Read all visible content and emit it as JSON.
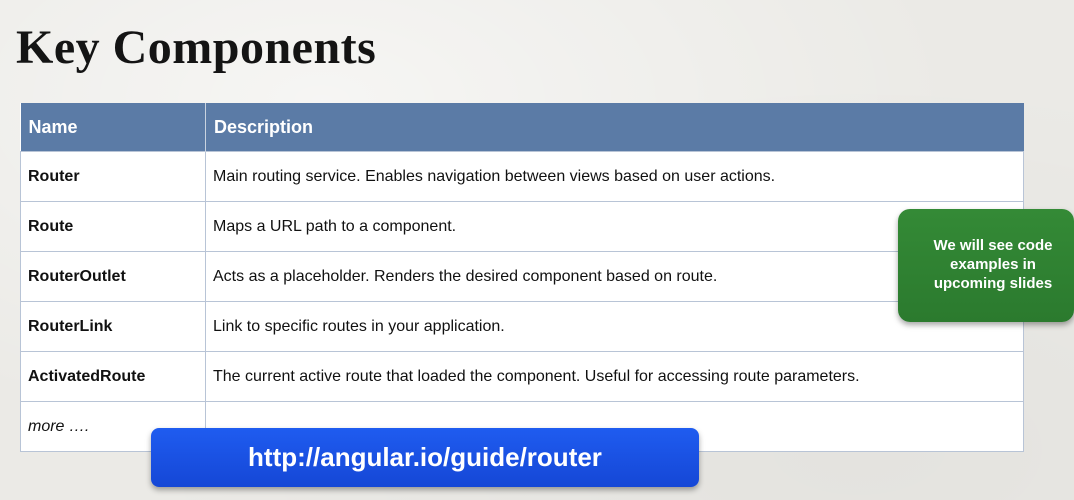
{
  "title": "Key Components",
  "table": {
    "headers": [
      "Name",
      "Description"
    ],
    "rows": [
      {
        "name": "Router",
        "description": "Main routing service. Enables navigation between views based on user actions."
      },
      {
        "name": "Route",
        "description": "Maps a URL path to a component."
      },
      {
        "name": "RouterOutlet",
        "description": "Acts as a placeholder. Renders the desired component based on route."
      },
      {
        "name": "RouterLink",
        "description": "Link to specific routes in your application."
      },
      {
        "name": "ActivatedRoute",
        "description": "The current active route that loaded the component. Useful for accessing route parameters."
      }
    ],
    "more_label": "more …."
  },
  "note": {
    "line1": "We will see code",
    "line2": "examples in",
    "line3": "upcoming slides"
  },
  "link": {
    "text": "http://angular.io/guide/router"
  },
  "colors": {
    "header_bg": "#5b7ba6",
    "note_bg": "#2e7d32",
    "link_bg": "#1f5cf0"
  }
}
